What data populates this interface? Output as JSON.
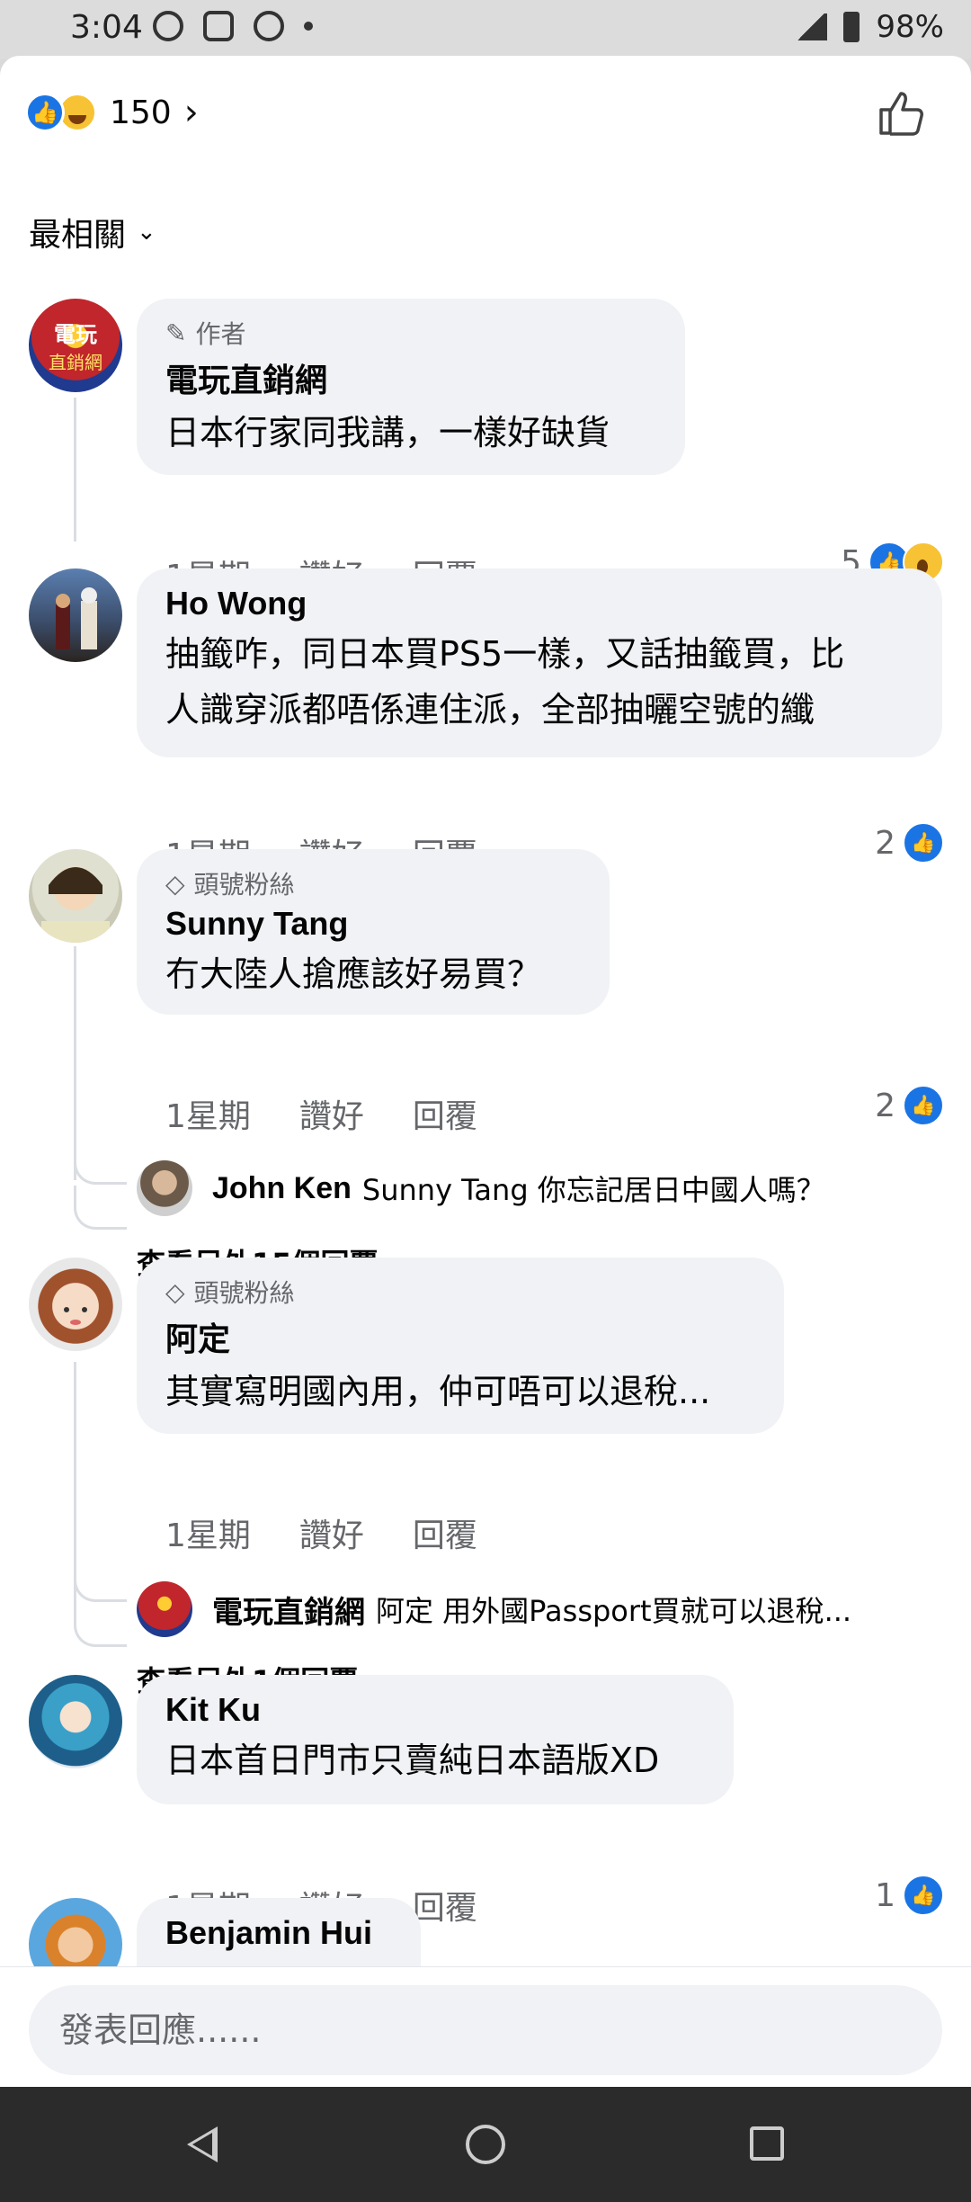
{
  "status_bar": {
    "time": "3:04",
    "battery": "98%"
  },
  "header": {
    "reaction_count": "150",
    "chevron": "›",
    "icons": [
      "like-reaction-icon",
      "haha-reaction-icon",
      "thumbs-up-outline-icon"
    ]
  },
  "sort": {
    "label": "最相關",
    "icon": "chevron-down-icon"
  },
  "comments": [
    {
      "badge": "作者",
      "badge_icon": "pencil-icon",
      "name": "電玩直銷網",
      "text": "日本行家同我講，一樣好缺貨",
      "time": "1星期",
      "like": "讚好",
      "reply": "回覆",
      "reactions": "5"
    },
    {
      "name": "Ho Wong",
      "text_lines": [
        "抽籤咋，同日本買PS5一樣，又話抽籤買，比",
        "人識穿派都唔係連住派，全部抽曬空號的纖"
      ],
      "time": "1星期",
      "like": "讚好",
      "reply": "回覆",
      "reactions": "2"
    },
    {
      "badge": "頭號粉絲",
      "badge_icon": "diamond-icon",
      "name": "Sunny Tang",
      "text": "冇大陸人搶應該好易買？",
      "time": "1星期",
      "like": "讚好",
      "reply": "回覆",
      "reactions": "2",
      "reply_preview": {
        "name": "John Ken",
        "text": "Sunny Tang 你忘記居日中國人嗎？"
      },
      "more": "查看另外15個回覆......"
    },
    {
      "badge": "頭號粉絲",
      "badge_icon": "diamond-icon",
      "name": "阿定",
      "text": "其實寫明國內用，仲可唔可以退稅...",
      "time": "1星期",
      "like": "讚好",
      "reply": "回覆",
      "reply_preview": {
        "name": "電玩直銷網",
        "text": "阿定 ￼￼用外國Passport買就可以退稅..."
      },
      "more": "查看另外1個回覆......"
    },
    {
      "name": "Kit Ku",
      "text": "日本首日門市只賣純日本語版XD",
      "time": "1星期",
      "like": "讚好",
      "reply": "回覆",
      "reactions": "1"
    },
    {
      "name": "Benjamin Hui"
    }
  ],
  "composer": {
    "placeholder": "發表回應......"
  },
  "colors": {
    "accent": "#1b74e4",
    "bubble": "#f0f2f5",
    "meta": "#65676b"
  }
}
